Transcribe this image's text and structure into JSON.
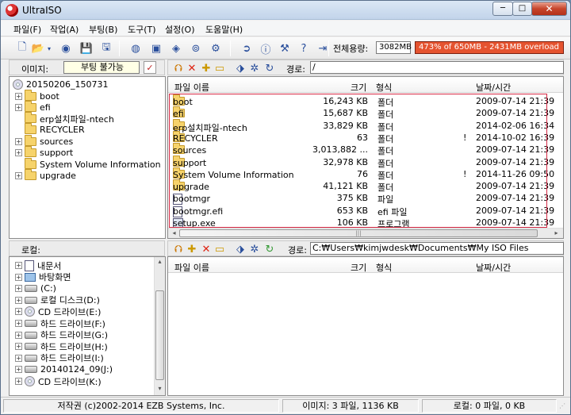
{
  "window": {
    "title": "UltraISO",
    "min": "─",
    "max": "□",
    "close": "✕"
  },
  "menu": [
    "파일(F)",
    "작업(A)",
    "부팅(B)",
    "도구(T)",
    "설정(O)",
    "도움말(H)"
  ],
  "toolbar": {
    "capacity_label": "전체용량:",
    "capacity_value": "3082MB",
    "capacity_bar_text": "473% of 650MB - 2431MB overload",
    "capacity_bar_color": "#e5532f"
  },
  "image_panel": {
    "label": "이미지:",
    "boot_status": "부팅 불가능",
    "path_label": "경로:",
    "path": "/",
    "tree": [
      {
        "label": "20150206_150731",
        "icon": "cd-icon",
        "expand": false,
        "level": 0
      },
      {
        "label": "boot",
        "icon": "folder-icon",
        "expand": true,
        "level": 1
      },
      {
        "label": "efi",
        "icon": "folder-icon",
        "expand": true,
        "level": 1
      },
      {
        "label": "erp설치파일-ntech",
        "icon": "folder-icon",
        "expand": false,
        "level": 1
      },
      {
        "label": "RECYCLER",
        "icon": "folder-icon",
        "expand": false,
        "level": 1
      },
      {
        "label": "sources",
        "icon": "folder-icon",
        "expand": true,
        "level": 1
      },
      {
        "label": "support",
        "icon": "folder-icon",
        "expand": true,
        "level": 1
      },
      {
        "label": "System Volume Information",
        "icon": "folder-icon",
        "expand": false,
        "level": 1
      },
      {
        "label": "upgrade",
        "icon": "folder-icon",
        "expand": true,
        "level": 1
      }
    ],
    "columns": [
      "파일 이름",
      "크기",
      "형식",
      "날짜/시간"
    ],
    "files": [
      {
        "name": "boot",
        "size": "16,243 KB",
        "type": "폴더",
        "flag": "",
        "date": "2009-07-14 21:39",
        "icon": "folder-icon"
      },
      {
        "name": "efi",
        "size": "15,687 KB",
        "type": "폴더",
        "flag": "",
        "date": "2009-07-14 21:39",
        "icon": "folder-icon"
      },
      {
        "name": "erp설치파일-ntech",
        "size": "33,829 KB",
        "type": "폴더",
        "flag": "",
        "date": "2014-02-06 16:34",
        "icon": "folder-icon"
      },
      {
        "name": "RECYCLER",
        "size": "63",
        "type": "폴더",
        "flag": "!",
        "date": "2014-10-02 16:39",
        "icon": "folder-icon"
      },
      {
        "name": "sources",
        "size": "3,013,882 ...",
        "type": "폴더",
        "flag": "",
        "date": "2009-07-14 21:39",
        "icon": "folder-icon"
      },
      {
        "name": "support",
        "size": "32,978 KB",
        "type": "폴더",
        "flag": "",
        "date": "2009-07-14 21:39",
        "icon": "folder-icon"
      },
      {
        "name": "System Volume Information",
        "size": "76",
        "type": "폴더",
        "flag": "!",
        "date": "2014-11-26 09:50",
        "icon": "folder-icon"
      },
      {
        "name": "upgrade",
        "size": "41,121 KB",
        "type": "폴더",
        "flag": "",
        "date": "2009-07-14 21:39",
        "icon": "folder-icon"
      },
      {
        "name": "bootmgr",
        "size": "375 KB",
        "type": "파일",
        "flag": "",
        "date": "2009-07-14 21:39",
        "icon": "file-icon"
      },
      {
        "name": "bootmgr.efi",
        "size": "653 KB",
        "type": "efi 파일",
        "flag": "",
        "date": "2009-07-14 21:39",
        "icon": "file-icon"
      },
      {
        "name": "setup.exe",
        "size": "106 KB",
        "type": "프로그램",
        "flag": "",
        "date": "2009-07-14 21:39",
        "icon": "exe-icon"
      }
    ]
  },
  "local_panel": {
    "label": "로컬:",
    "path_label": "경로:",
    "path": "C:₩Users₩kimjwdesk₩Documents₩My ISO Files",
    "tree": [
      {
        "label": "내문서",
        "icon": "documents-icon",
        "expand": true
      },
      {
        "label": "바탕화면",
        "icon": "desktop-icon",
        "expand": true
      },
      {
        "label": "(C:)",
        "icon": "drive-icon",
        "expand": true
      },
      {
        "label": "로컬 디스크(D:)",
        "icon": "drive-icon",
        "expand": true
      },
      {
        "label": "CD 드라이브(E:)",
        "icon": "cd-drive-icon",
        "expand": true
      },
      {
        "label": "하드 드라이브(F:)",
        "icon": "drive-icon",
        "expand": true
      },
      {
        "label": "하드 드라이브(G:)",
        "icon": "drive-icon",
        "expand": true
      },
      {
        "label": "하드 드라이브(H:)",
        "icon": "drive-icon",
        "expand": true
      },
      {
        "label": "하드 드라이브(I:)",
        "icon": "drive-icon",
        "expand": true
      },
      {
        "label": "20140124_09(J:)",
        "icon": "drive-icon",
        "expand": true
      },
      {
        "label": "CD 드라이브(K:)",
        "icon": "cd-drive-icon",
        "expand": true
      }
    ],
    "columns": [
      "파일 이름",
      "크기",
      "형식",
      "날짜/시간"
    ]
  },
  "status": {
    "copyright": "저작권 (c)2002-2014 EZB Systems, Inc.",
    "image_info": "이미지: 3 파일, 1136 KB",
    "local_info": "로컬: 0 파일, 0 KB"
  }
}
